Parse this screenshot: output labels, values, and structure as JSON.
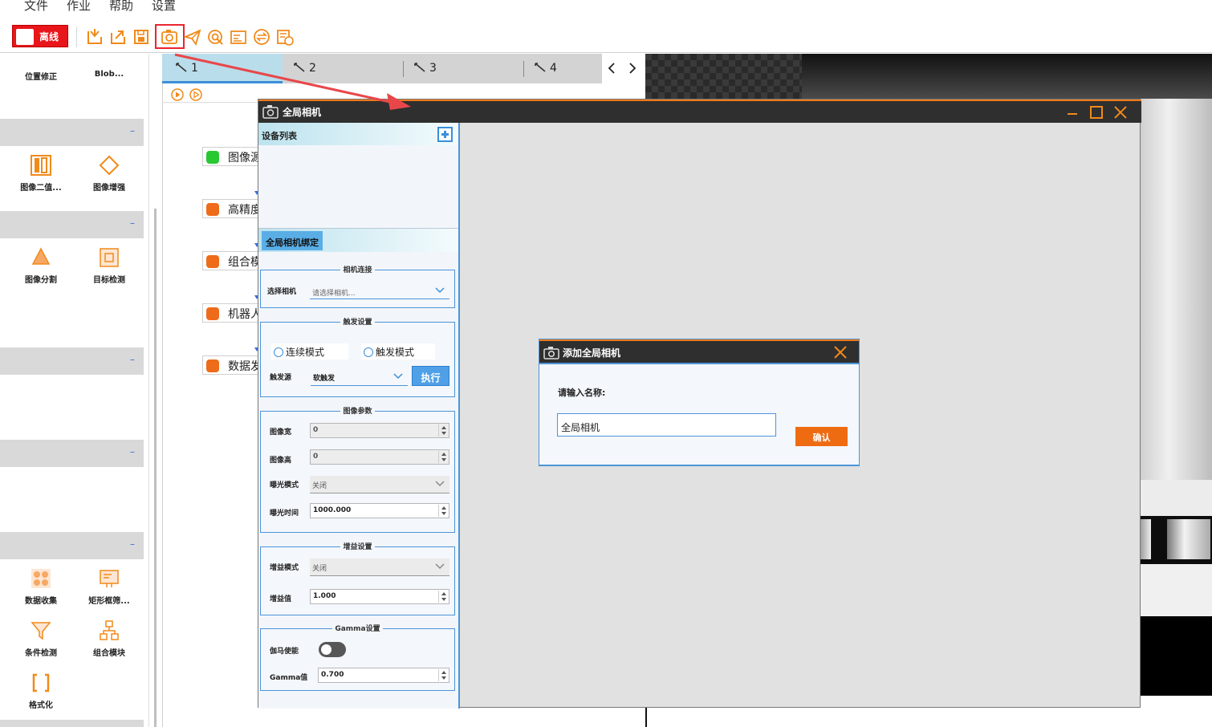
{
  "menu": [
    "文件",
    "作业",
    "帮助",
    "设置"
  ],
  "toolbar": {
    "status_label": "离线",
    "icons": [
      "import-icon",
      "export-icon",
      "save-icon",
      "camera-icon",
      "send-icon",
      "target-icon",
      "form-icon",
      "exchange-icon",
      "schedule-icon"
    ],
    "highlight_color": "#e8262f"
  },
  "palette": {
    "top_tools": [
      "位置修正",
      "Blob..."
    ],
    "group1": [
      "图像二值...",
      "图像增强"
    ],
    "group2": [
      "图像分割",
      "目标检测"
    ],
    "group3": [
      "数据收集",
      "矩形框筛...",
      "条件检测",
      "组合模块",
      "格式化"
    ],
    "band_marker": "–"
  },
  "flow": {
    "tabs": [
      "1",
      "2",
      "3",
      "4"
    ],
    "nodes": [
      "图像源",
      "高精度",
      "组合模块",
      "机器人",
      "数据发送"
    ]
  },
  "camera_window": {
    "title": "全局相机",
    "device_list_label": "设备列表",
    "binding_tab": "全局相机绑定",
    "connection": {
      "title": "相机连接",
      "select_label": "选择相机",
      "select_placeholder": "请选择相机..."
    },
    "trigger": {
      "title": "触发设置",
      "mode_continuous": "连续模式",
      "mode_trigger": "触发模式",
      "source_label": "触发源",
      "source_value": "软触发",
      "execute_label": "执行"
    },
    "image_params": {
      "title": "图像参数",
      "width_label": "图像宽",
      "width_value": "0",
      "height_label": "图像高",
      "height_value": "0",
      "exposure_mode_label": "曝光模式",
      "exposure_mode_value": "关闭",
      "exposure_time_label": "曝光时间",
      "exposure_time_value": "1000.000"
    },
    "gain": {
      "title": "增益设置",
      "mode_label": "增益模式",
      "mode_value": "关闭",
      "value_label": "增益值",
      "value": "1.000"
    },
    "gamma": {
      "title": "Gamma设置",
      "enable_label": "伽马使能",
      "enabled": false,
      "value_label": "Gamma值",
      "value": "0.700"
    }
  },
  "add_dialog": {
    "title": "添加全局相机",
    "prompt": "请输入名称:",
    "input_value": "全局相机",
    "confirm_label": "确认"
  },
  "colors": {
    "accent_orange": "#ef6b12",
    "accent_blue": "#4c94d9",
    "title_bar": "#2f2f2f",
    "offline_red": "#e8151b"
  }
}
